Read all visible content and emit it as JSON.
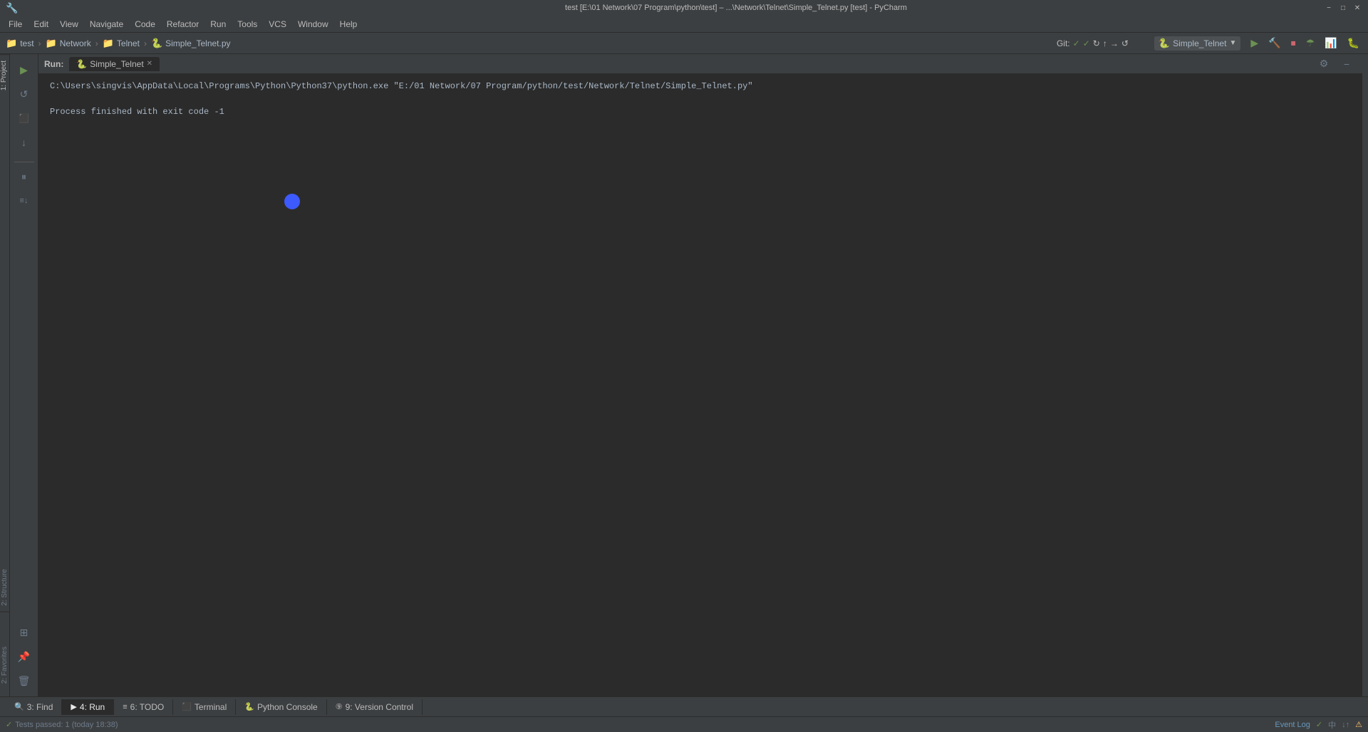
{
  "titlebar": {
    "title": "test [E:\\01 Network\\07 Program\\python\\test] – ...\\Network\\Telnet\\Simple_Telnet.py [test] - PyCharm",
    "minimize": "−",
    "maximize": "□",
    "close": "✕"
  },
  "menubar": {
    "items": [
      "File",
      "Edit",
      "View",
      "Navigate",
      "Code",
      "Refactor",
      "Run",
      "Tools",
      "VCS",
      "Window",
      "Help"
    ]
  },
  "navbar": {
    "items": [
      {
        "icon": "folder",
        "label": "test"
      },
      {
        "icon": "folder",
        "label": "Network"
      },
      {
        "icon": "folder",
        "label": "Telnet"
      },
      {
        "icon": "file",
        "label": "Simple_Telnet.py"
      }
    ]
  },
  "toolbar": {
    "run_config": "Simple_Telnet",
    "git_label": "Git:",
    "settings_icon": "⚙",
    "minimize_panel": "−"
  },
  "run_panel": {
    "label": "Run:",
    "tab_name": "Simple_Telnet",
    "tab_close": "✕",
    "output_line1": "C:\\Users\\singvis\\AppData\\Local\\Programs\\Python\\Python37\\python.exe \"E:/01 Network/07 Program/python/test/Network/Telnet/Simple_Telnet.py\"",
    "output_line2": "",
    "output_line3": "Process finished with exit code -1"
  },
  "bottom_tabs": [
    {
      "icon": "🔍",
      "number": "3",
      "label": "Find"
    },
    {
      "icon": "▶",
      "number": "4",
      "label": "Run",
      "active": true
    },
    {
      "icon": "≡",
      "number": "6",
      "label": "TODO"
    },
    {
      "icon": "⬛",
      "number": "",
      "label": "Terminal"
    },
    {
      "icon": "🐍",
      "number": "",
      "label": "Python Console"
    },
    {
      "icon": "⑨",
      "number": "9",
      "label": "Version Control"
    }
  ],
  "status_bar": {
    "test_status": "Tests passed: 1 (today 18:38)",
    "event_log": "Event Log",
    "right_icons": [
      "✓",
      "中",
      "✓",
      "↑↓",
      "⚠"
    ]
  },
  "sidebar_labels": {
    "project": "1: Project",
    "structure": "2: Structure",
    "favorites": "2: Favorites"
  },
  "tool_buttons": {
    "run": "▶",
    "stop": "⬛",
    "rerun": "↺",
    "scroll_to_end": "↓",
    "pause": "⏸",
    "step": "👣",
    "pin": "📌",
    "trash": "🗑"
  },
  "colors": {
    "bg_dark": "#2b2b2b",
    "bg_medium": "#3c3f41",
    "accent_green": "#6a9153",
    "accent_blue": "#3d5afe",
    "text_main": "#a9b7c6",
    "text_dim": "#6d7b8b"
  }
}
